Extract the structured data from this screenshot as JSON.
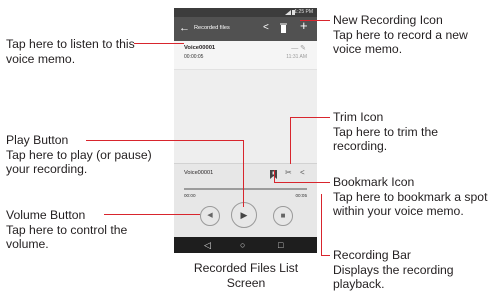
{
  "phone": {
    "status_time": "1:25 PM",
    "app_title": "Recorded files",
    "back_icon": "back-arrow-icon",
    "list_item": {
      "name": "Voice00001",
      "duration": "00:00:05",
      "time": "11:31 AM"
    },
    "player": {
      "name": "Voice00001",
      "time_start": "00:00",
      "time_end": "00:05",
      "progress": 1.0
    },
    "navbar_icons": [
      "back-triangle-icon",
      "home-circle-icon",
      "recents-square-icon"
    ]
  },
  "callouts": {
    "listen": {
      "text": "Tap here to listen to this voice memo."
    },
    "play": {
      "title": "Play Button",
      "desc": "Tap here to play (or pause) your recording."
    },
    "volume": {
      "title": "Volume Button",
      "desc": "Tap here to control the volume."
    },
    "new_recording": {
      "title": "New Recording Icon",
      "desc": "Tap here to record a new voice memo."
    },
    "trim": {
      "title": "Trim Icon",
      "desc": "Tap here to trim the recording."
    },
    "bookmark": {
      "title": "Bookmark Icon",
      "desc": "Tap here to bookmark a spot within your voice memo."
    },
    "recording_bar": {
      "title": "Recording Bar",
      "desc": "Displays the recording playback."
    }
  },
  "caption": "Recorded Files List Screen",
  "colors": {
    "callout_line": "#d8252d",
    "appbar": "#515151",
    "navbar": "#1e1e1e"
  }
}
